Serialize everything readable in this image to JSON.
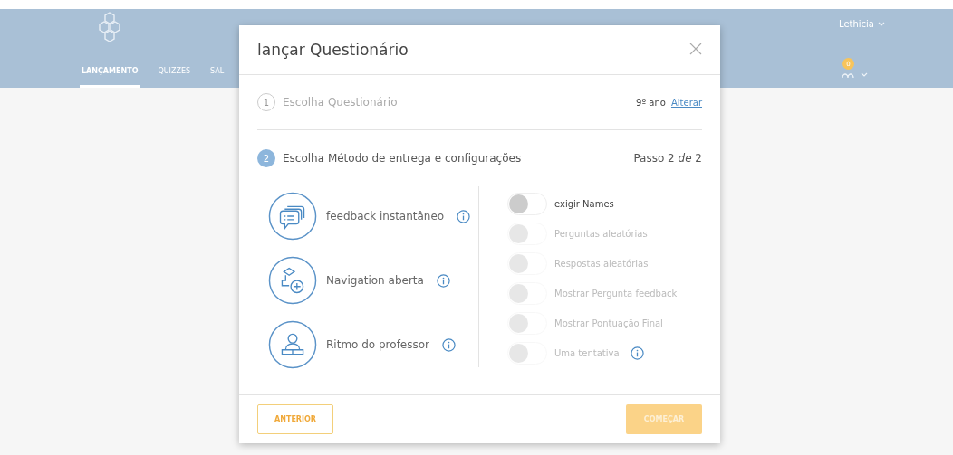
{
  "header": {
    "nav": [
      {
        "label": "LANÇAMENTO",
        "selected": true
      },
      {
        "label": "QUIZZES",
        "selected": false
      },
      {
        "label": "SAL",
        "selected": false
      }
    ],
    "user": {
      "name": "Lethicia"
    },
    "notifications": {
      "count": "0"
    }
  },
  "modal": {
    "title": "lançar Questionário",
    "step1": {
      "active": false,
      "number": "1",
      "label": "Escolha Questionário",
      "grade": "9º ano",
      "change_link": "Alterar"
    },
    "step2": {
      "active": true,
      "number": "2",
      "label": "Escolha Método de entrega e configurações",
      "progress": "Passo 2 *de* 2"
    },
    "methods": [
      {
        "kind": "feedback",
        "label": "feedback instantâneo"
      },
      {
        "kind": "navigation",
        "label": "Navigation aberta"
      },
      {
        "kind": "teacher",
        "label": "Ritmo do professor"
      }
    ],
    "options": [
      {
        "label": "exigir Names",
        "on": false,
        "disabled": false,
        "info": false
      },
      {
        "label": "Perguntas aleatórias",
        "on": false,
        "disabled": true,
        "info": false
      },
      {
        "label": "Respostas aleatórias",
        "on": false,
        "disabled": true,
        "info": false
      },
      {
        "label": "Mostrar Pergunta feedback",
        "on": false,
        "disabled": true,
        "info": false
      },
      {
        "label": "Mostrar Pontuação Final",
        "on": false,
        "disabled": true,
        "info": false
      },
      {
        "label": "Uma tentativa",
        "on": false,
        "disabled": true,
        "info": true
      }
    ],
    "buttons": {
      "back": {
        "label": "ANTERIOR",
        "disabled": false
      },
      "start": {
        "label": "COMEÇAR",
        "disabled": true
      }
    }
  }
}
